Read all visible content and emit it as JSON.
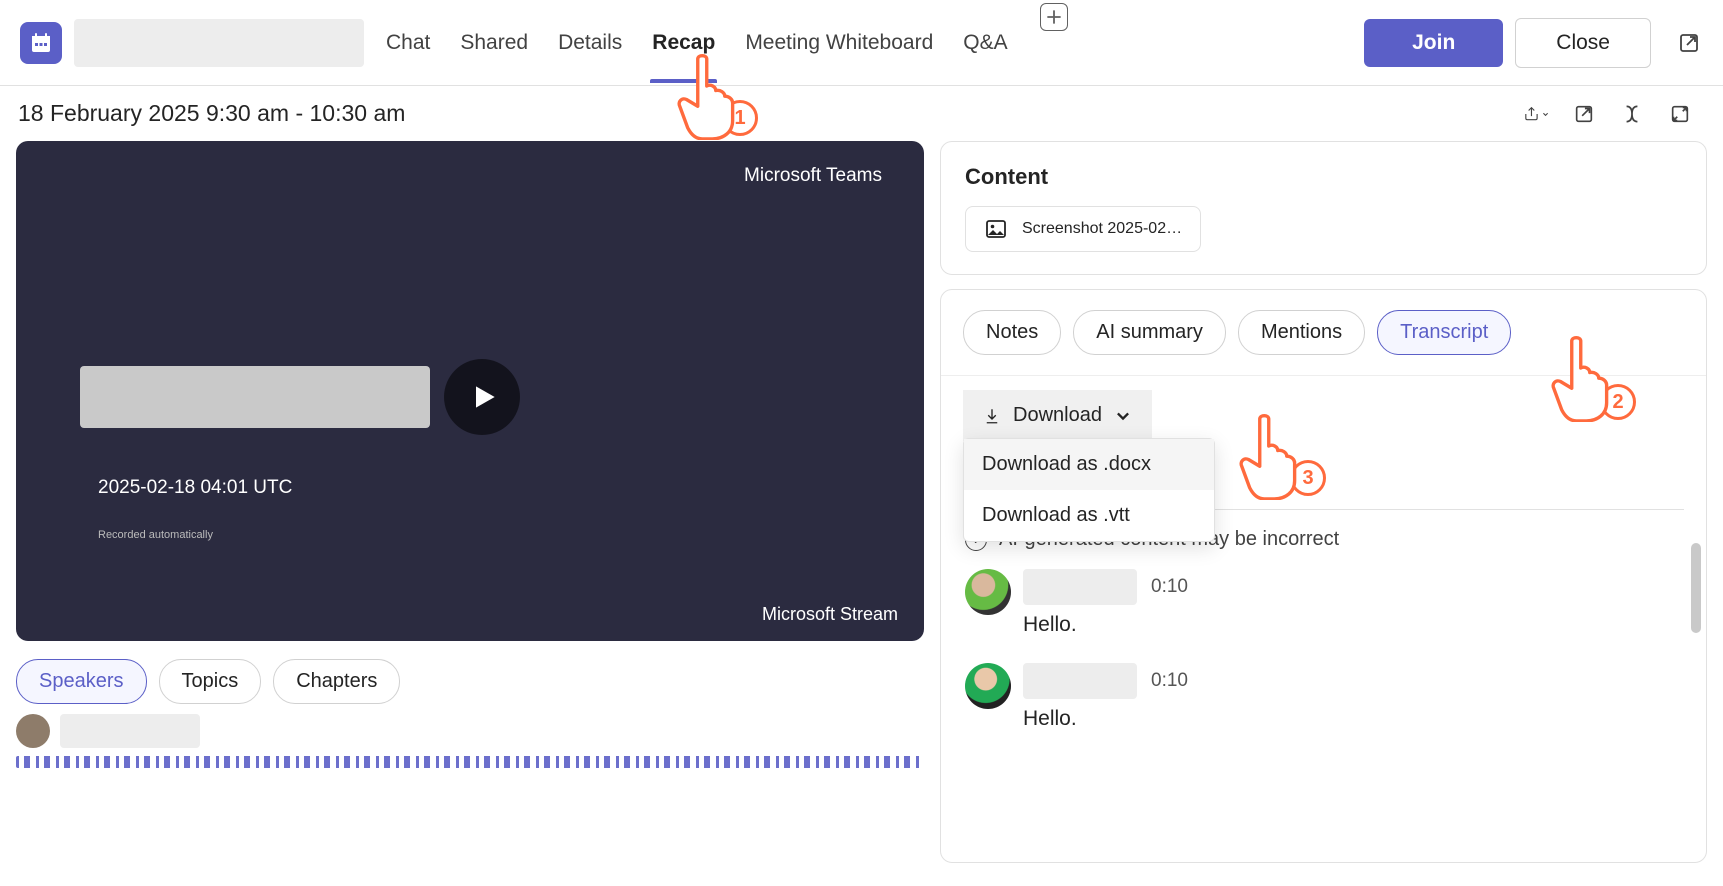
{
  "nav": {
    "tabs": [
      "Chat",
      "Shared",
      "Details",
      "Recap",
      "Meeting Whiteboard",
      "Q&A"
    ],
    "activeIndex": 3,
    "join": "Join",
    "close": "Close"
  },
  "meetingTime": "18 February 2025 9:30 am - 10:30 am",
  "video": {
    "topRight": "Microsoft Teams",
    "utc": "2025-02-18 04:01 UTC",
    "auto": "Recorded automatically",
    "bottomRight": "Microsoft Stream"
  },
  "videoTabs": {
    "items": [
      "Speakers",
      "Topics",
      "Chapters"
    ],
    "activeIndex": 0
  },
  "content": {
    "title": "Content",
    "item": "Screenshot 2025-02…"
  },
  "rightTabs": {
    "items": [
      "Notes",
      "AI summary",
      "Mentions",
      "Transcript"
    ],
    "activeIndex": 3
  },
  "download": {
    "label": "Download",
    "options": [
      "Download as .docx",
      "Download as .vtt"
    ]
  },
  "aiNote": "AI-generated content may be incorrect",
  "transcript": [
    {
      "time": "0:10",
      "text": "Hello."
    },
    {
      "time": "0:10",
      "text": "Hello."
    }
  ],
  "badges": {
    "one": "1",
    "two": "2",
    "three": "3"
  }
}
